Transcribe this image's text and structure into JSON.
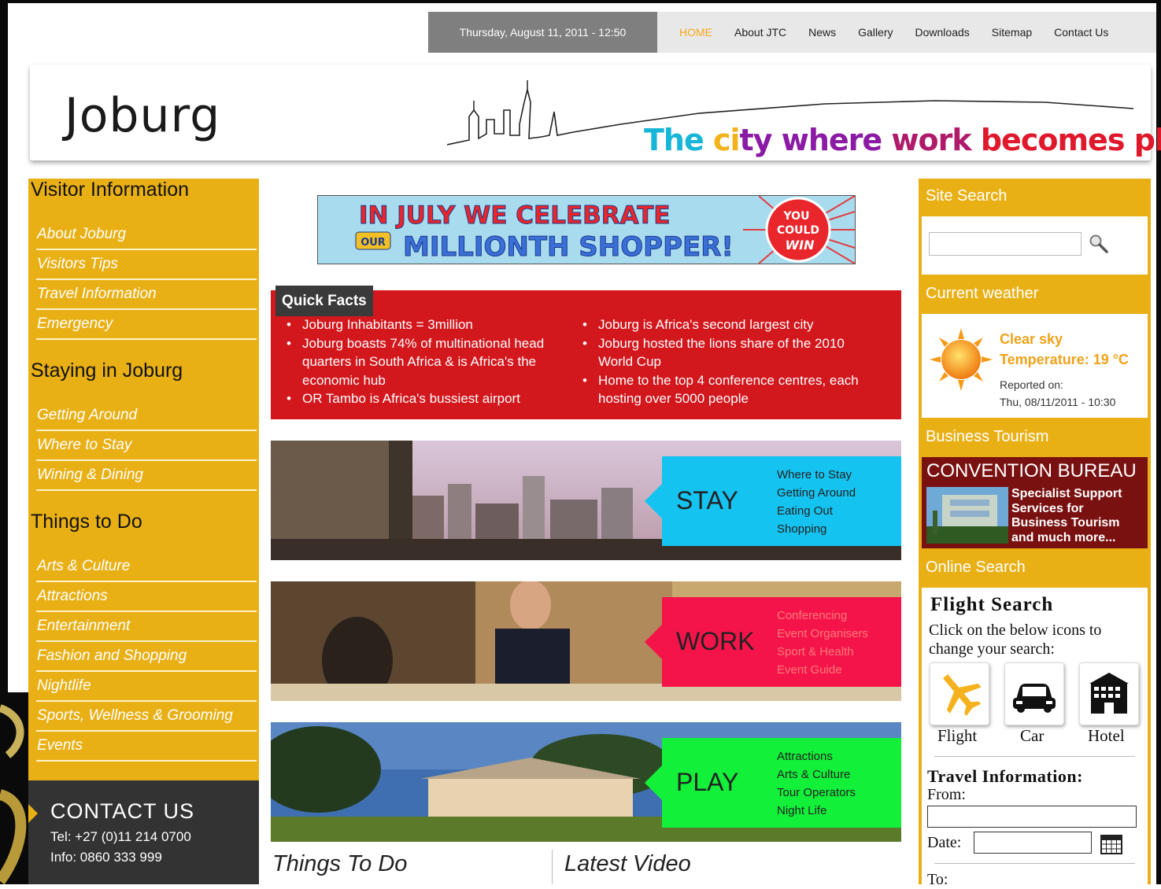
{
  "topbar": {
    "datetime": "Thursday, August 11, 2011 - 12:50",
    "nav": [
      "HOME",
      "About JTC",
      "News",
      "Gallery",
      "Downloads",
      "Sitemap",
      "Contact Us"
    ],
    "active_color": "#f6a81c"
  },
  "header": {
    "logo": "Joburg",
    "tagline_parts": [
      {
        "text": "The ",
        "color": "#17b6d8"
      },
      {
        "text": "c",
        "color": "#f2b21a"
      },
      {
        "text": "i",
        "color": "#f2b21a"
      },
      {
        "text": "ty ",
        "color": "#8b1aa4"
      },
      {
        "text": "where ",
        "color": "#8b1aa4"
      },
      {
        "text": "work ",
        "color": "#b01a6a"
      },
      {
        "text": "becomes ",
        "color": "#e0182c"
      },
      {
        "text": "play.",
        "color": "#e0182c"
      }
    ]
  },
  "sidebar": {
    "sections": [
      {
        "heading": "Visitor Information",
        "items": [
          "About Joburg",
          "Visitors Tips",
          "Travel Information",
          "Emergency"
        ]
      },
      {
        "heading": "Staying in Joburg",
        "items": [
          "Getting Around",
          "Where to Stay",
          "Wining & Dining"
        ]
      },
      {
        "heading": "Things to Do",
        "items": [
          "Arts & Culture",
          "Attractions",
          "Entertainment",
          "Fashion and Shopping",
          "Nightlife",
          "Sports, Wellness & Grooming",
          "Events"
        ]
      }
    ],
    "color": "#e9b016"
  },
  "contact": {
    "title": "CONTACT US",
    "tel": "Tel: +27 (0)11 214 0700",
    "info": "Info: 0860 333 999"
  },
  "banner": {
    "line1": "IN JULY WE CELEBRATE",
    "our": "OUR",
    "line2": "MILLIONTH SHOPPER!",
    "badge": [
      "YOU",
      "COULD",
      "WIN"
    ]
  },
  "quick_facts": {
    "title": "Quick Facts",
    "col1": [
      "Joburg Inhabitants = 3million",
      "Joburg boasts 74% of multinational head quarters in South Africa & is Africa's the economic hub",
      "OR Tambo is Africa's bussiest airport"
    ],
    "col2": [
      "Joburg is Africa's second largest city",
      "Joburg hosted the lions share of the 2010 World Cup",
      "Home to the top 4 conference centres, each hosting over 5000 people"
    ]
  },
  "features": [
    {
      "title": "STAY",
      "color": "#15c3f0",
      "links": [
        "Where to Stay",
        "Getting Around",
        "Eating Out",
        "Shopping"
      ],
      "link_color": "#222222"
    },
    {
      "title": "WORK",
      "color": "#f5144a",
      "links": [
        "Conferencing",
        "Event Organisers",
        "Sport & Health",
        "Event Guide"
      ],
      "link_color": "#ff6a6a"
    },
    {
      "title": "PLAY",
      "color": "#12f03a",
      "links": [
        "Attractions",
        "Arts & Culture",
        "Tour Operators",
        "Night Life"
      ],
      "link_color": "#222222"
    }
  ],
  "bottom": {
    "things_to_do": "Things To Do",
    "latest_video": "Latest Video"
  },
  "right": {
    "site_search": "Site Search",
    "current_weather": "Current weather",
    "weather": {
      "condition": "Clear sky",
      "temperature": "Temperature: 19 °C",
      "reported_label": "Reported on:",
      "reported_date": "Thu, 08/11/2011 - 10:30"
    },
    "business_tourism": "Business Tourism",
    "convention": {
      "title": "CONVENTION BUREAU",
      "lines": [
        "Specialist Support",
        "Services for",
        "Business Tourism",
        "and much more..."
      ]
    },
    "online_search": "Online Search",
    "flight_search": {
      "title": "Flight Search",
      "desc": "Click on the below icons to change your search:",
      "options": [
        "Flight",
        "Car",
        "Hotel"
      ]
    },
    "travel_info": {
      "title": "Travel Information:",
      "from": "From:",
      "date": "Date:",
      "to": "To:"
    }
  }
}
